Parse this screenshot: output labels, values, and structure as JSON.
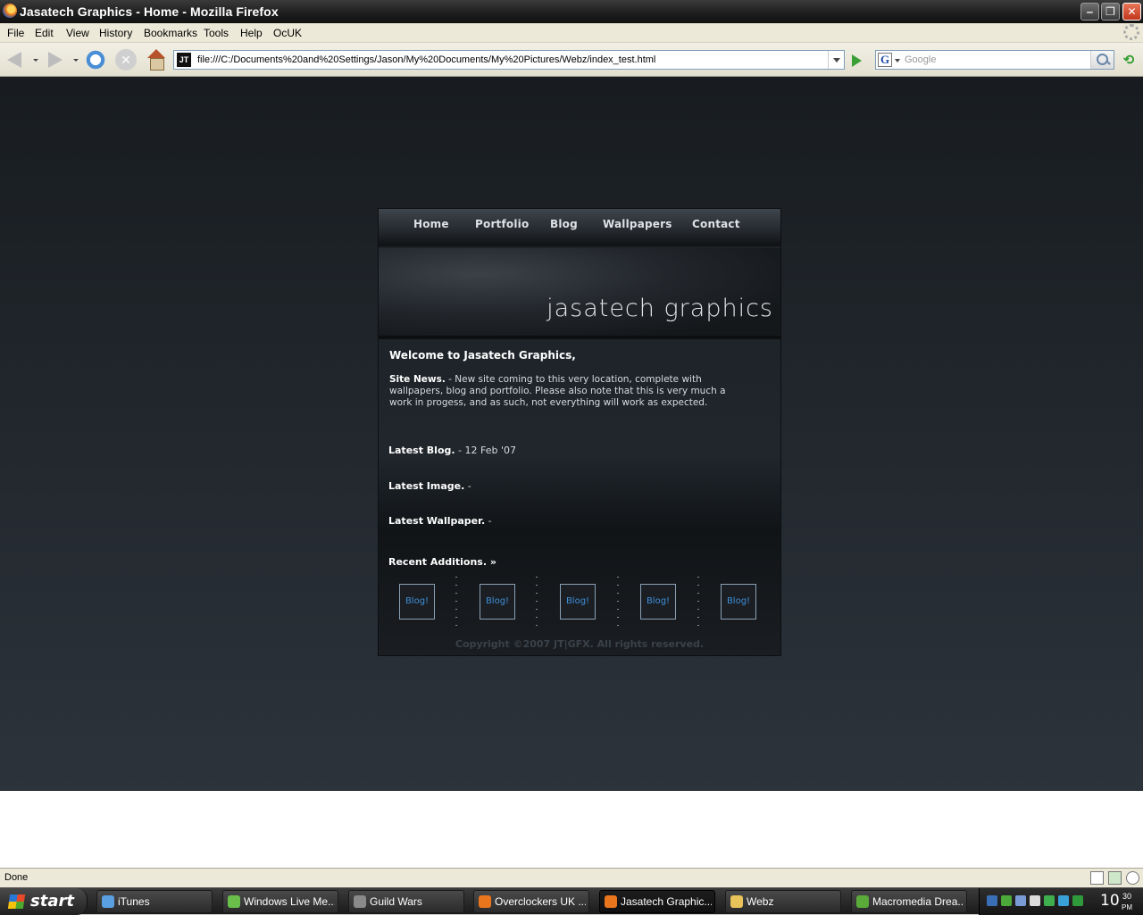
{
  "window": {
    "title": "Jasatech Graphics - Home - Mozilla Firefox",
    "minimize": "‒",
    "maximize": "❐",
    "close": "✕"
  },
  "menubar": [
    "File",
    "Edit",
    "View",
    "History",
    "Bookmarks",
    "Tools",
    "Help",
    "OcUK"
  ],
  "toolbar": {
    "url": "file:///C:/Documents%20and%20Settings/Jason/My%20Documents/My%20Pictures/Webz/index_test.html",
    "favicon_text": "JT",
    "search_placeholder": "Google",
    "search_engine_glyph": "G",
    "stop_glyph": "✕",
    "extension_glyph": "⟲"
  },
  "site": {
    "nav": [
      "Home",
      "Portfolio",
      "Blog",
      "Wallpapers",
      "Contact"
    ],
    "logo": "jasatech graphics",
    "welcome": "Welcome to Jasatech Graphics,",
    "news_label": "Site News.",
    "news_text": " - New site coming to this very location, complete with wallpapers, blog and portfolio. Please also note that this is very much a work in progess, and as such, not everything will work as expected.",
    "latest_blog_label": "Latest Blog.",
    "latest_blog_value": " - 12 Feb '07",
    "latest_image_label": "Latest Image.",
    "latest_image_value": " -",
    "latest_wallpaper_label": "Latest Wallpaper.",
    "latest_wallpaper_value": " -",
    "recent_additions": "Recent Additions. »",
    "thumbs": [
      "Blog!",
      "Blog!",
      "Blog!",
      "Blog!",
      "Blog!"
    ],
    "copyright": "Copyright ©2007 JT|GFX. All rights reserved."
  },
  "status": {
    "text": "Done"
  },
  "taskbar": {
    "start": "start",
    "tasks": [
      {
        "label": "iTunes",
        "icon_color": "#5aa0e0"
      },
      {
        "label": "Windows Live Me...",
        "icon_color": "#6abf4b"
      },
      {
        "label": "Guild Wars",
        "icon_color": "#8a8a8a"
      },
      {
        "label": "Overclockers UK ...",
        "icon_color": "#e9761d"
      },
      {
        "label": "Jasatech Graphic...",
        "icon_color": "#e9761d"
      },
      {
        "label": "Webz",
        "icon_color": "#e8c35a"
      },
      {
        "label": "Macromedia Drea...",
        "icon_color": "#5aaa3a"
      }
    ],
    "clock_hour": "10",
    "clock_minute": "30",
    "clock_ampm": "PM"
  }
}
